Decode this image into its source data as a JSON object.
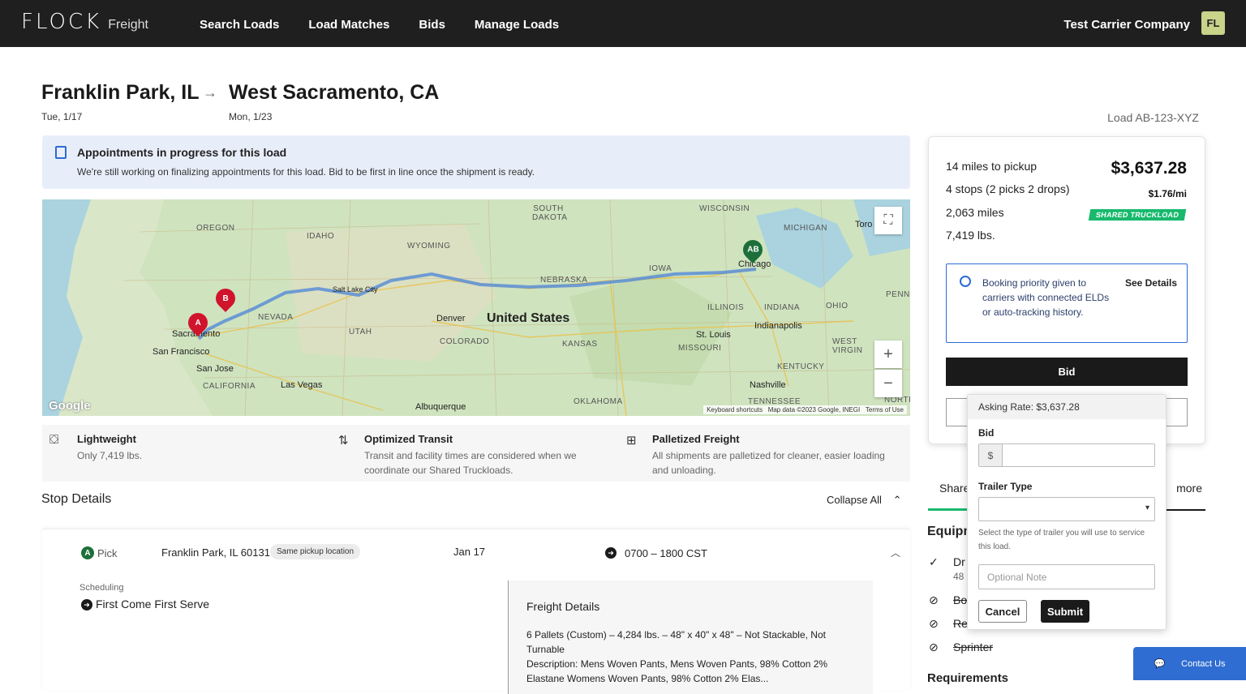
{
  "nav": {
    "logo": "FLOCK",
    "logo_sub": "Freight",
    "links": [
      "Search Loads",
      "Load Matches",
      "Bids",
      "Manage Loads"
    ],
    "company": "Test Carrier Company",
    "avatar": "FL"
  },
  "load": {
    "origin": "Franklin Park, IL",
    "destination": "West Sacramento, CA",
    "origin_date": "Tue, 1/17",
    "dest_date": "Mon, 1/23",
    "load_id": "Load AB-123-XYZ"
  },
  "banner": {
    "title": "Appointments in progress for this load",
    "text": "We're still working on finalizing appointments for this load. Bid to be first in line once the shipment is ready."
  },
  "map": {
    "states": [
      "OREGON",
      "IDAHO",
      "WYOMING",
      "SOUTH DAKOTA",
      "WISCONSIN",
      "MICHIGAN",
      "IOWA",
      "NEBRASKA",
      "NEVADA",
      "UTAH",
      "COLORADO",
      "KANSAS",
      "MISSOURI",
      "ILLINOIS",
      "INDIANA",
      "OHIO",
      "CALIFORNIA",
      "KENTUCKY",
      "TENNESSEE",
      "OKLAHOMA",
      "WEST VIRGIN",
      "PENN",
      "NORTH"
    ],
    "cities": [
      "Salt Lake City",
      "Denver",
      "Chicago",
      "Sacramento",
      "San Francisco",
      "San Jose",
      "Las Vegas",
      "Albuquerque",
      "St. Louis",
      "Indianapolis",
      "Nashville",
      "Toro"
    ],
    "country": "United States",
    "pin_a": "A",
    "pin_b": "B",
    "pin_ab": "AB",
    "attribution": [
      "Keyboard shortcuts",
      "Map data ©2023 Google, INEGI",
      "Terms of Use"
    ],
    "google": "Google",
    "zoom_in": "+",
    "zoom_out": "−"
  },
  "features": [
    {
      "title": "Lightweight",
      "text": "Only 7,419 lbs."
    },
    {
      "title": "Optimized Transit",
      "text": "Transit and facility times are considered when we coordinate our Shared Truckloads."
    },
    {
      "title": "Palletized Freight",
      "text": "All shipments are palletized for cleaner, easier loading and unloading."
    }
  ],
  "stops": {
    "heading": "Stop Details",
    "collapse": "Collapse All",
    "badge": "A",
    "type": "Pick",
    "address": "Franklin Park, IL 60131",
    "same_badge": "Same pickup location",
    "date": "Jan 17",
    "time": "0700 – 1800 CST",
    "sched_label": "Scheduling",
    "sched_value": "First Come First Serve",
    "freight_title": "Freight Details",
    "freight_text": "6 Pallets (Custom) – 4,284 lbs. – 48\" x 40\" x 48\" – Not Stackable, Not Turnable",
    "freight_desc": "Description: Mens Woven Pants, Mens Woven Pants, 98% Cotton 2% Elastane Womens Woven Pants, 98% Cotton 2% Elas..."
  },
  "side": {
    "stats": [
      "14 miles to pickup",
      "4 stops (2 picks 2 drops)",
      "2,063 miles",
      "7,419 lbs."
    ],
    "price": "$3,637.28",
    "per_mile": "$1.76/mi",
    "shared": "SHARED TRUCKLOAD",
    "priority_text": "Booking priority given to carriers with connected ELDs or auto-tracking history.",
    "priority_link": "See Details",
    "bid_label": "Bid"
  },
  "tabs": {
    "share": "Share",
    "more": "more"
  },
  "equipment": {
    "heading": "Equipn",
    "rows": [
      {
        "label": "Dr",
        "sub": "48",
        "allowed": true
      },
      {
        "label": "Bo",
        "allowed": false
      },
      {
        "label": "Re",
        "allowed": false
      },
      {
        "label": "Sprinter",
        "allowed": false
      }
    ],
    "requirements": "Requirements"
  },
  "popover": {
    "asking": "Asking Rate: $3,637.28",
    "bid_label": "Bid",
    "currency": "$",
    "trailer_label": "Trailer Type",
    "help": "Select the type of trailer you will use to service this load.",
    "note_placeholder": "Optional Note",
    "cancel": "Cancel",
    "submit": "Submit"
  },
  "contact": "Contact Us",
  "colors": {
    "accent": "#2b6cd6",
    "green": "#18b96d",
    "pin_red": "#d0142c",
    "pin_green": "#1d6f3a"
  }
}
